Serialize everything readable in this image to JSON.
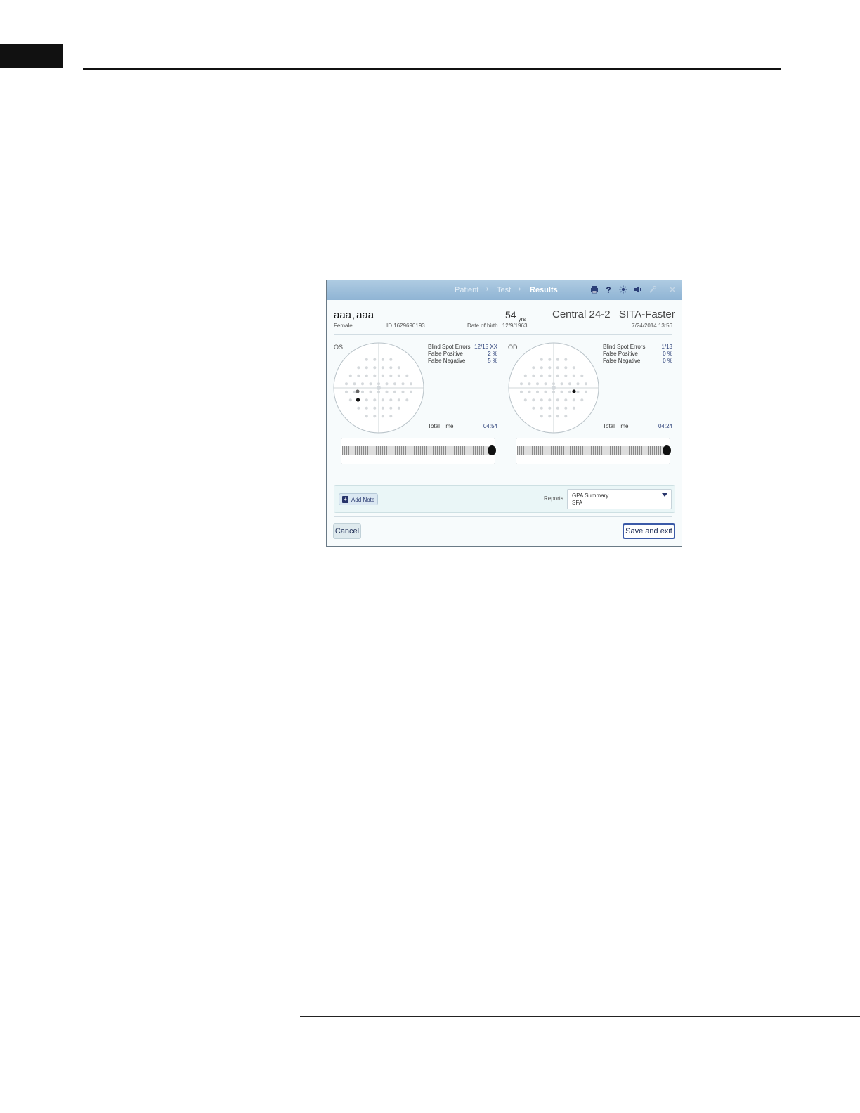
{
  "app": {
    "breadcrumb": [
      {
        "label": "Patient",
        "active": false
      },
      {
        "label": "Test",
        "active": false
      },
      {
        "label": "Results",
        "active": true
      }
    ],
    "toolbar_icons": [
      "printer-icon",
      "help-icon",
      "brightness-icon",
      "volume-icon",
      "wrench-icon",
      "close-icon"
    ]
  },
  "patient": {
    "name_first": "aaa",
    "name_sep": ",",
    "name_last": "aaa",
    "gender": "Female",
    "id_label": "ID",
    "id_value": "1629690193",
    "age": "54",
    "age_unit": "yrs",
    "dob_label": "Date of birth",
    "dob_value": "12/9/1963"
  },
  "test": {
    "pattern": "Central 24-2",
    "strategy": "SITA-Faster",
    "datetime": "7/24/2014 13:56"
  },
  "eyes": [
    {
      "label": "OS",
      "stats": [
        {
          "label": "Blind Spot Errors",
          "value": "12/15 XX"
        },
        {
          "label": "False Positive",
          "value": "2 %"
        },
        {
          "label": "False Negative",
          "value": "5 %"
        }
      ],
      "total_time_label": "Total Time",
      "total_time_value": "04:54"
    },
    {
      "label": "OD",
      "stats": [
        {
          "label": "Blind Spot Errors",
          "value": "1/13"
        },
        {
          "label": "False Positive",
          "value": "0 %"
        },
        {
          "label": "False Negative",
          "value": "0 %"
        }
      ],
      "total_time_label": "Total Time",
      "total_time_value": "04:24"
    }
  ],
  "notes": {
    "add_note_label": "Add Note",
    "reports_label": "Reports",
    "reports_options": [
      "GPA Summary",
      "SFA"
    ]
  },
  "actions": {
    "cancel_label": "Cancel",
    "save_label": "Save and exit"
  },
  "colors": {
    "titlebar": "#8fb4d4",
    "accent": "#3b5aa8",
    "value_text": "#2b3f78"
  }
}
